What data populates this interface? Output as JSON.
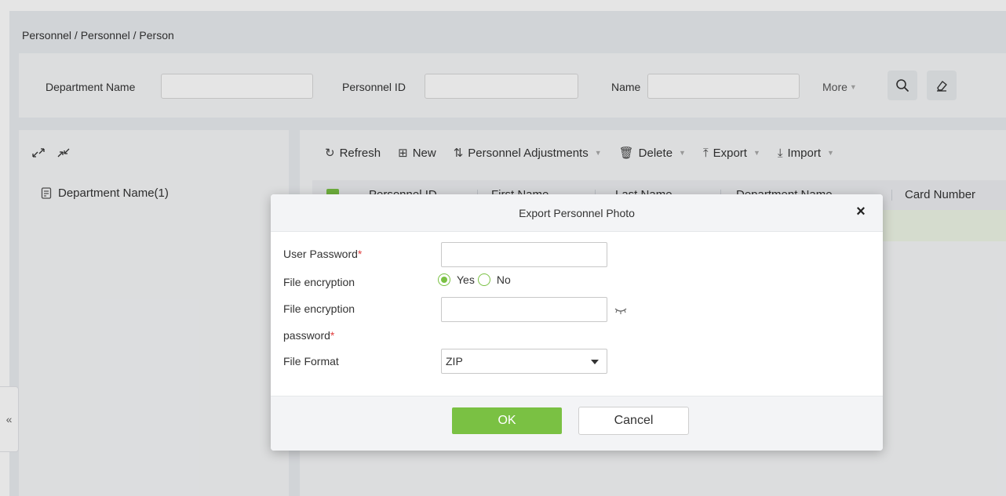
{
  "breadcrumb": "Personnel / Personnel / Person",
  "search": {
    "department_label": "Department Name",
    "department_value": "",
    "personnel_id_label": "Personnel ID",
    "personnel_id_value": "",
    "name_label": "Name",
    "name_value": "",
    "more_label": "More"
  },
  "tree": {
    "items": [
      {
        "label": "Department Name(1)"
      }
    ]
  },
  "toolbar": {
    "refresh": "Refresh",
    "new": "New",
    "adjustments": "Personnel Adjustments",
    "delete": "Delete",
    "export": "Export",
    "import": "Import"
  },
  "table": {
    "columns": [
      "Personnel ID",
      "First Name",
      "Last Name",
      "Department Name",
      "Card Number"
    ]
  },
  "modal": {
    "title": "Export Personnel Photo",
    "user_password_label": "User Password",
    "user_password_value": "",
    "file_encryption_label": "File encryption",
    "encryption_yes": "Yes",
    "encryption_no": "No",
    "encryption_selected": "Yes",
    "encryption_password_label_1": "File encryption",
    "encryption_password_label_2": "password",
    "encryption_password_value": "",
    "file_format_label": "File Format",
    "file_format_value": "ZIP",
    "required_mark": "*",
    "ok_label": "OK",
    "cancel_label": "Cancel"
  },
  "colors": {
    "accent": "#7ac143",
    "required": "#e04040"
  },
  "icons": {
    "refresh": "refresh-icon",
    "new": "new-icon",
    "adjustments": "adjust-icon",
    "delete": "trash-icon",
    "export": "export-icon",
    "import": "import-icon",
    "search": "search-icon",
    "clear": "eraser-icon",
    "close": "close-icon",
    "eye": "eye-closed-icon",
    "tree_node": "department-icon",
    "expand": "expand-icon",
    "collapse": "collapse-icon",
    "sidebar_toggle": "double-chevron-left-icon"
  }
}
